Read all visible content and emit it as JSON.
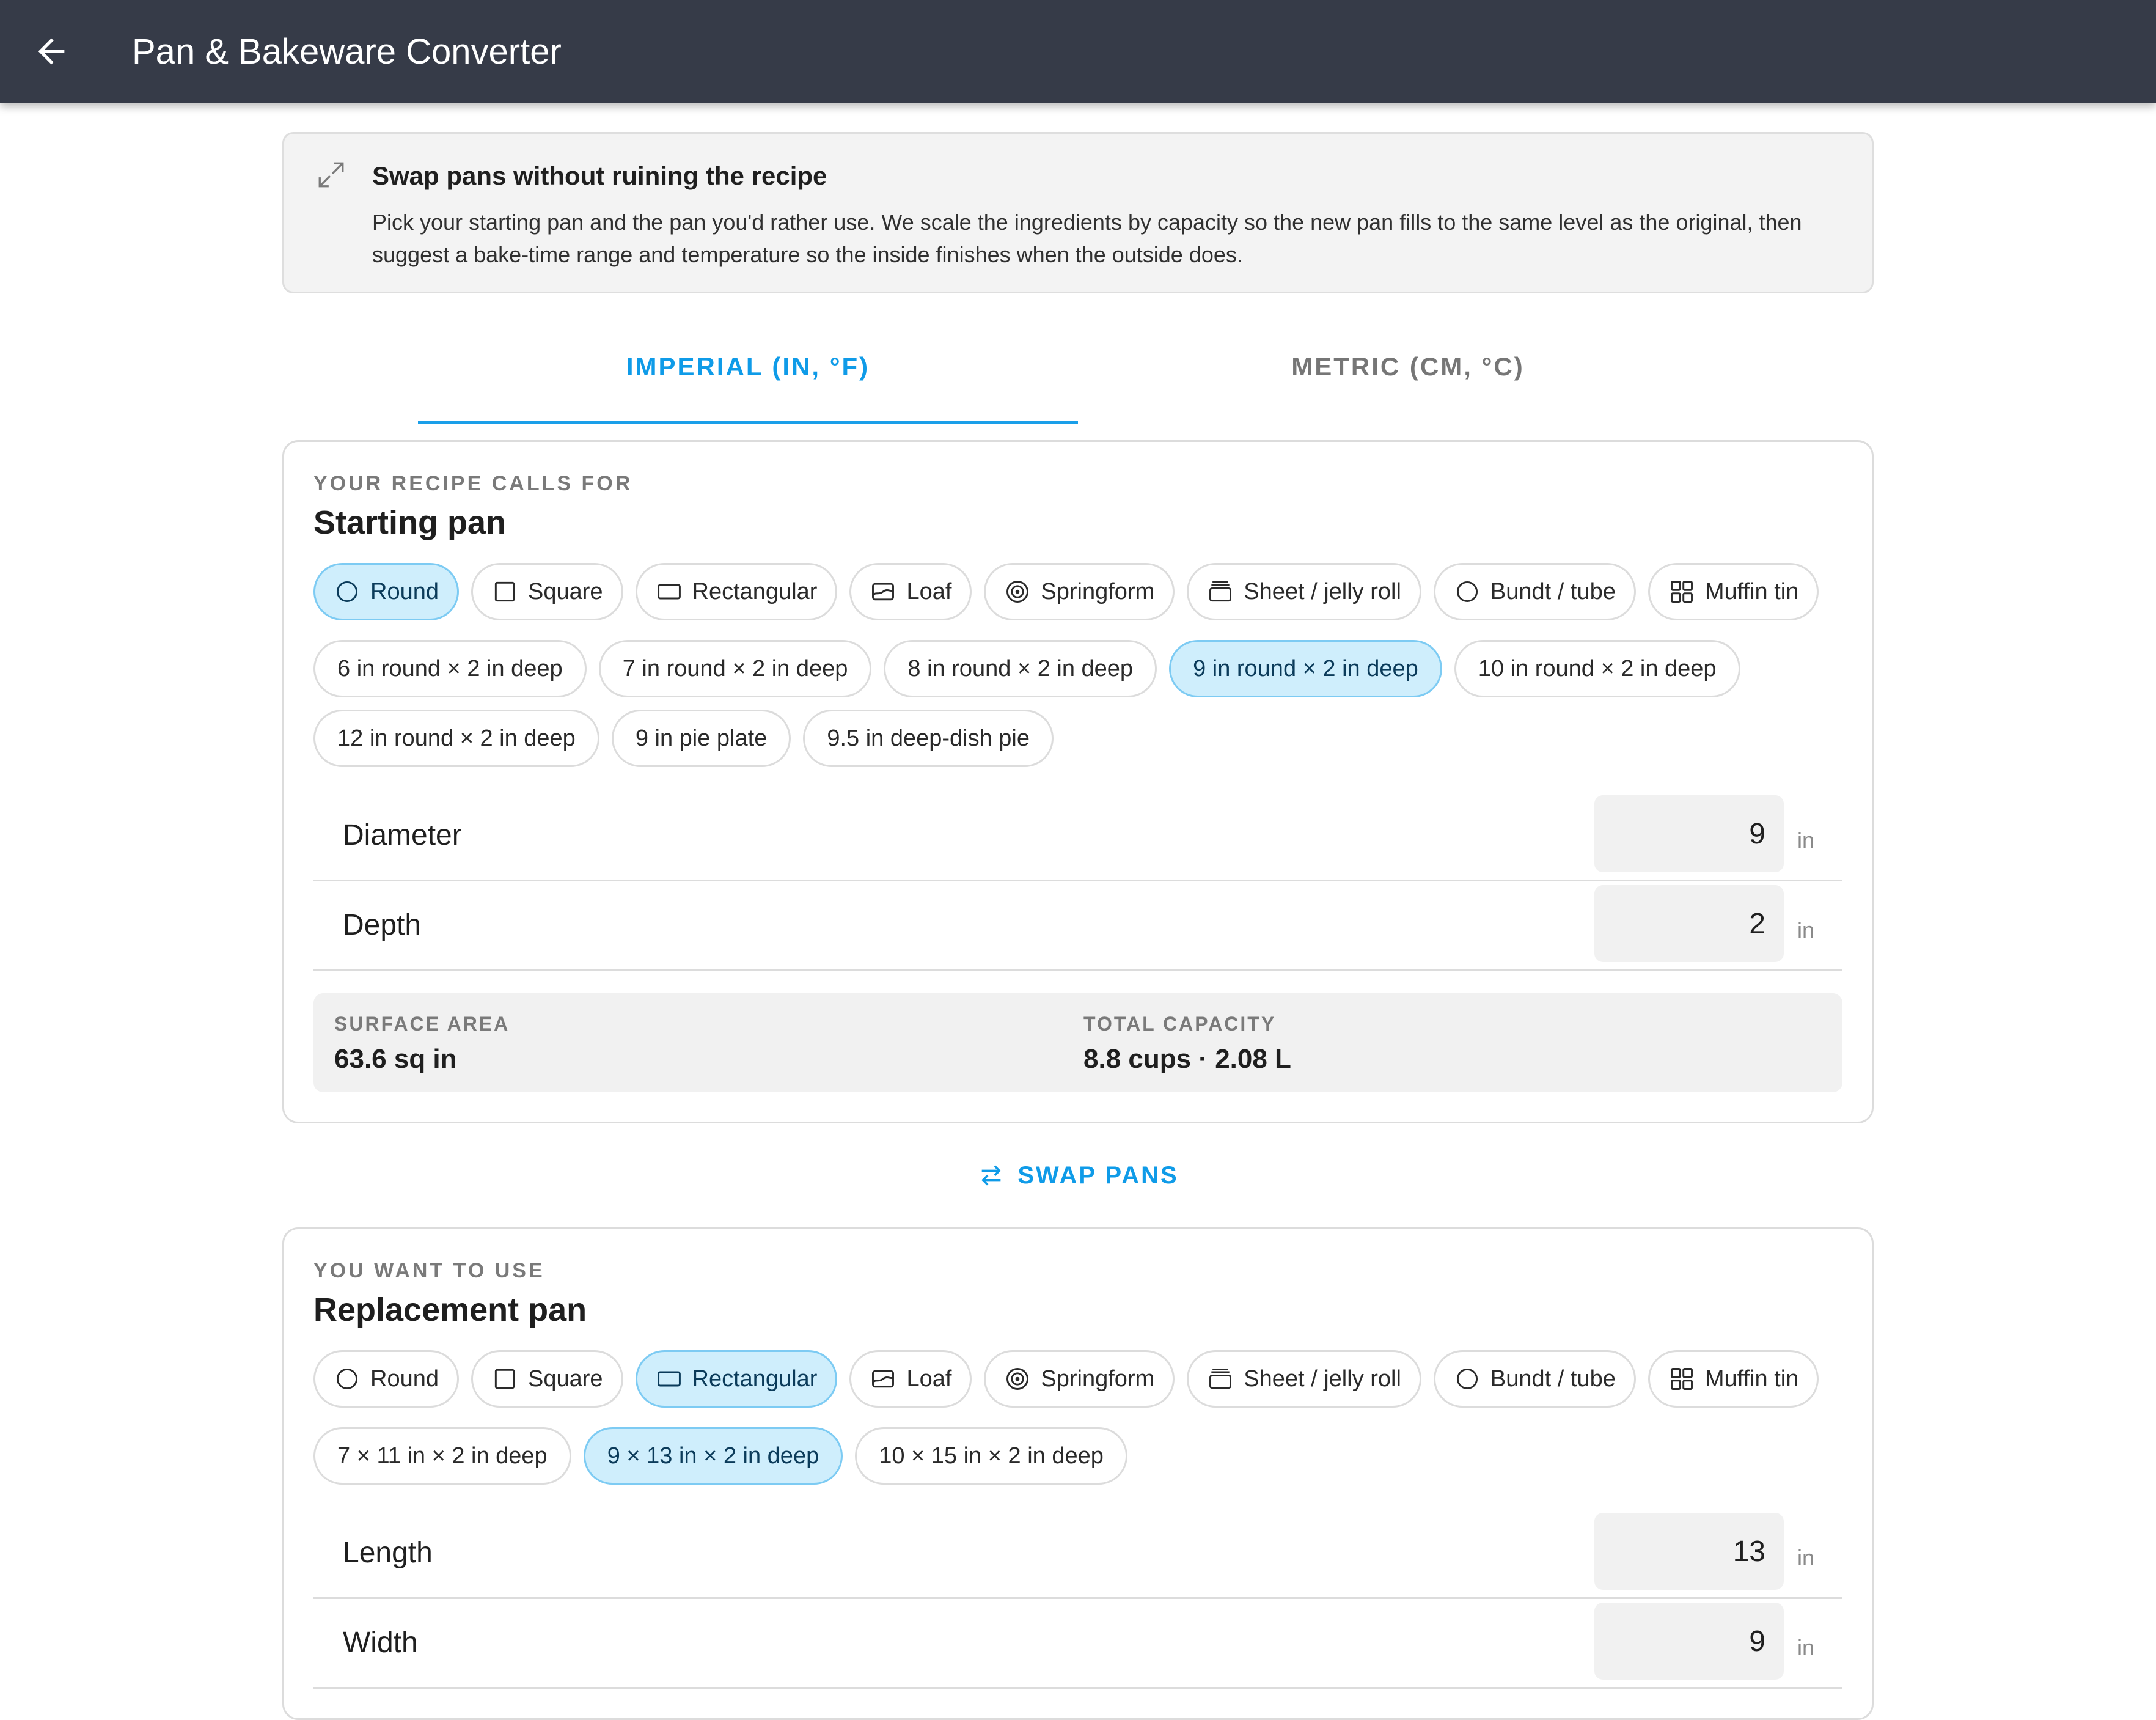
{
  "app": {
    "title": "Pan & Bakeware Converter",
    "back_icon": "arrow-left-icon"
  },
  "info": {
    "icon": "resize-diagonal-icon",
    "title": "Swap pans without ruining the recipe",
    "body": "Pick your starting pan and the pan you'd rather use. We scale the ingredients by capacity so the new pan fills to the same level as the original, then suggest a bake-time range and temperature so the inside finishes when the outside does."
  },
  "tabs": [
    {
      "label": "IMPERIAL (IN, °F)",
      "selected": true
    },
    {
      "label": "METRIC (CM, °C)",
      "selected": false
    }
  ],
  "colors": {
    "accent": "#0f9be8",
    "selected_chip_bg": "#cfeefc",
    "appbar": "#363b48"
  },
  "shapes": [
    "Round",
    "Square",
    "Rectangular",
    "Loaf",
    "Springform",
    "Sheet / jelly roll",
    "Bundt / tube",
    "Muffin tin"
  ],
  "starting": {
    "eyebrow": "YOUR RECIPE CALLS FOR",
    "title": "Starting pan",
    "selected_shape": "Round",
    "sizes": [
      "6 in round × 2 in deep",
      "7 in round × 2 in deep",
      "8 in round × 2 in deep",
      "9 in round × 2 in deep",
      "10 in round × 2 in deep",
      "12 in round × 2 in deep",
      "9 in pie plate",
      "9.5 in deep-dish pie"
    ],
    "selected_size": "9 in round × 2 in deep",
    "dims": [
      {
        "label": "Diameter",
        "value": "9",
        "unit": "in"
      },
      {
        "label": "Depth",
        "value": "2",
        "unit": "in"
      }
    ],
    "surface_label": "SURFACE AREA",
    "surface_value": "63.6 sq in",
    "capacity_label": "TOTAL CAPACITY",
    "capacity_value": "8.8 cups · 2.08 L"
  },
  "swap": {
    "label": "SWAP PANS",
    "icon": "swap-arrows-icon"
  },
  "replacement": {
    "eyebrow": "YOU WANT TO USE",
    "title": "Replacement pan",
    "selected_shape": "Rectangular",
    "sizes": [
      "7 × 11 in × 2 in deep",
      "9 × 13 in × 2 in deep",
      "10 × 15 in × 2 in deep"
    ],
    "selected_size": "9 × 13 in × 2 in deep",
    "dims": [
      {
        "label": "Length",
        "value": "13",
        "unit": "in"
      },
      {
        "label": "Width",
        "value": "9",
        "unit": "in"
      }
    ]
  }
}
